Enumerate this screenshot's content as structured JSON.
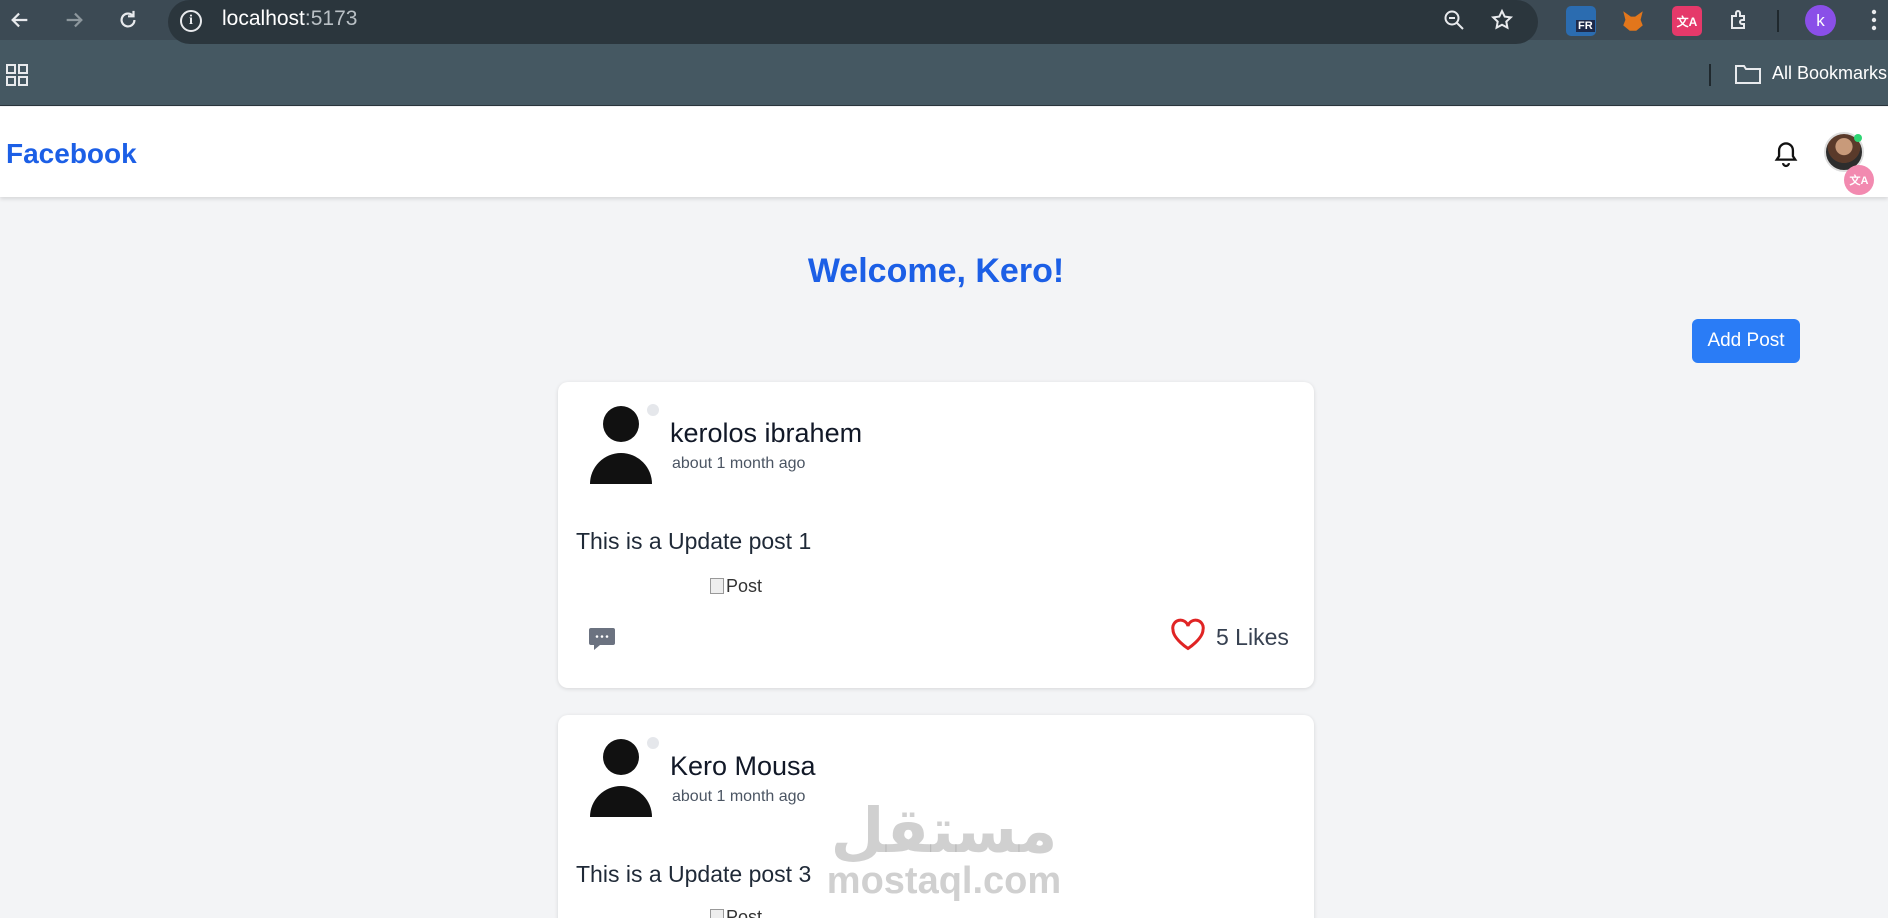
{
  "browser": {
    "url_host": "localhost",
    "url_port": ":5173",
    "bookmarks_label": "All Bookmarks",
    "profile_initial": "k",
    "ext_fr_label": "FR"
  },
  "header": {
    "brand": "Facebook"
  },
  "main": {
    "welcome": "Welcome, Kero!",
    "add_post_label": "Add Post"
  },
  "posts": [
    {
      "author": "kerolos ibrahem",
      "time": "about 1 month ago",
      "text": "This is a Update post 1",
      "image_alt": "Post",
      "likes": "5 Likes"
    },
    {
      "author": "Kero Mousa",
      "time": "about 1 month ago",
      "text": "This is a Update post 3",
      "image_alt": "Post"
    }
  ],
  "watermark": {
    "arabic": "مستقل",
    "latin": "mostaql.com"
  },
  "colors": {
    "brand": "#1c5fe6",
    "button": "#2a7cf6",
    "like": "#e02424"
  }
}
